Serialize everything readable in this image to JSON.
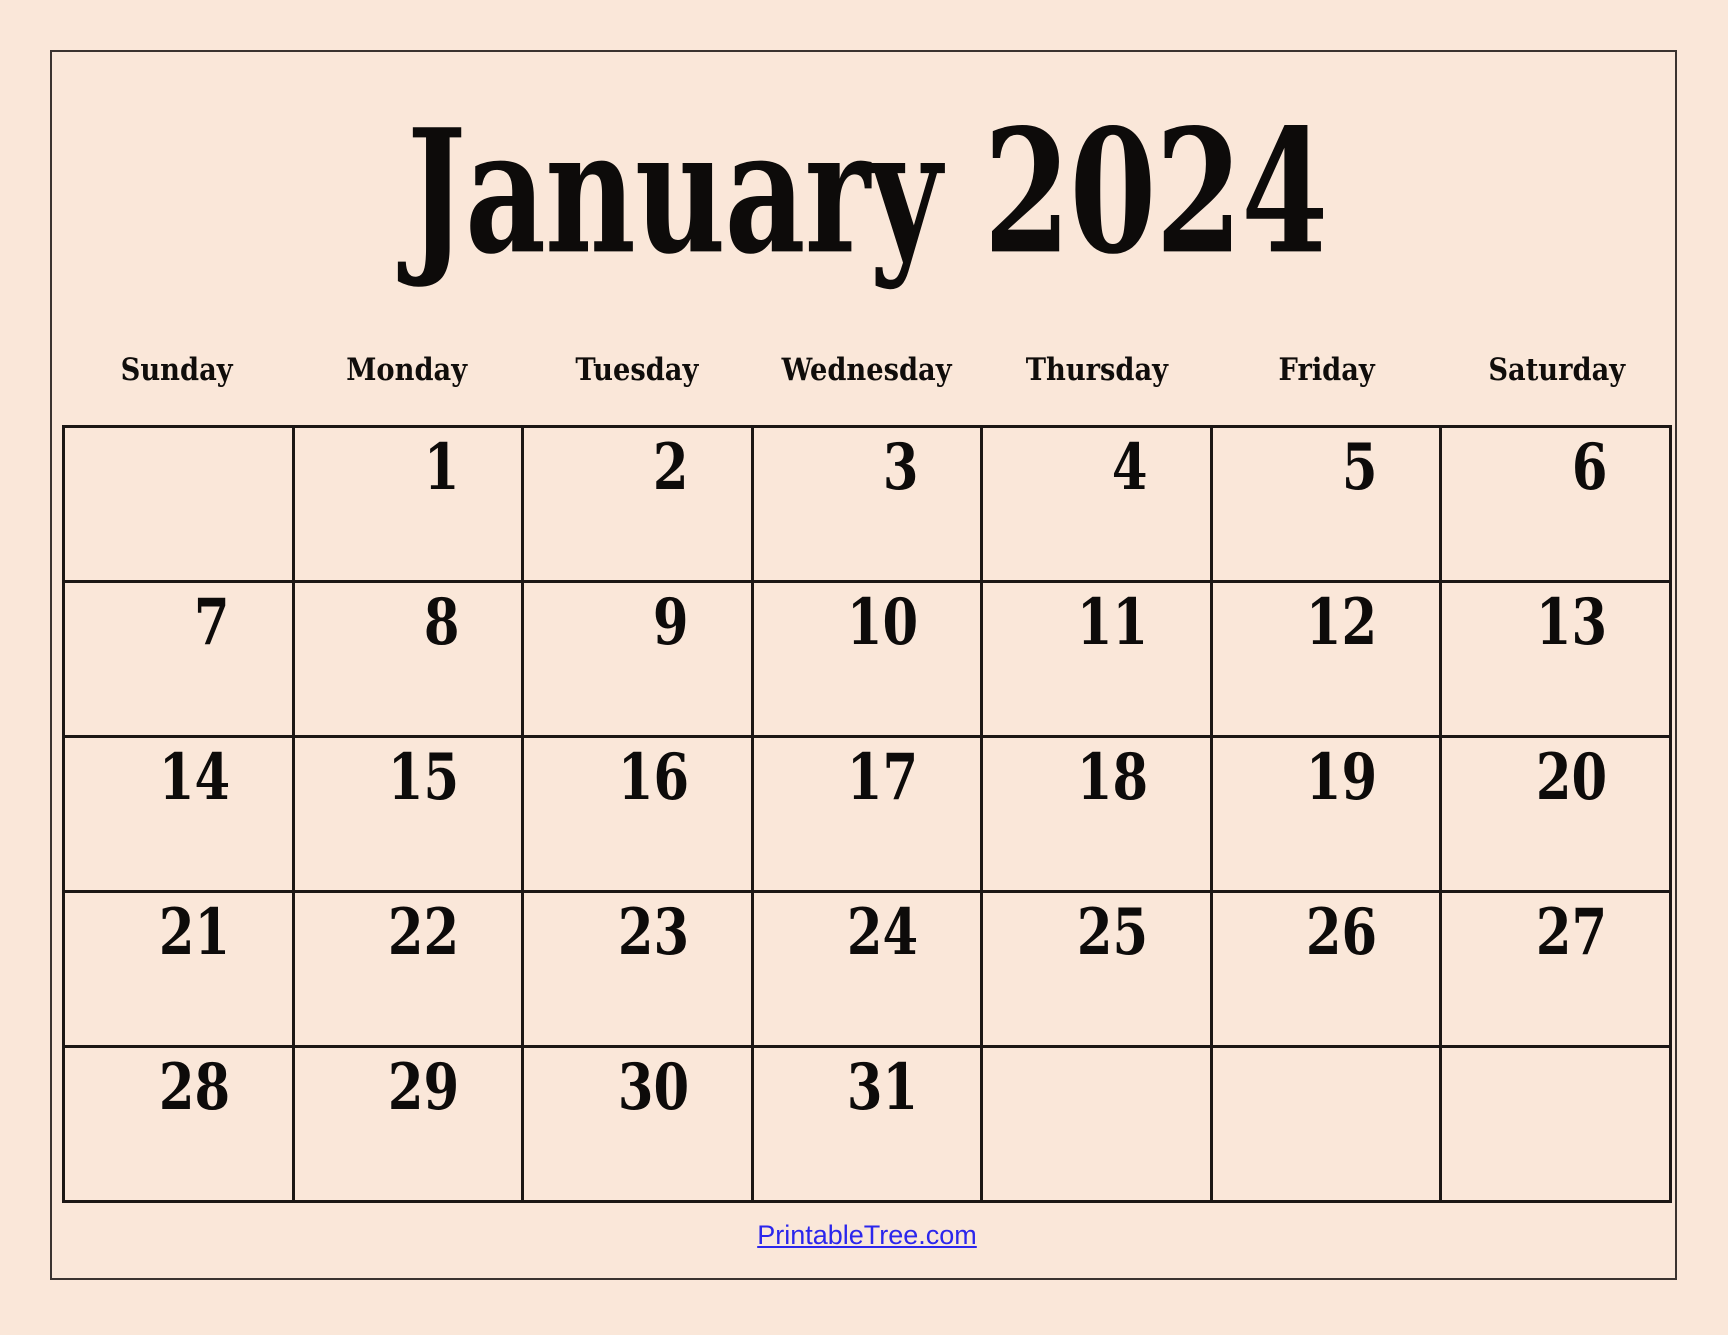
{
  "theme": {
    "background_color": "#FAE7D9",
    "ink_color": "#0D0B0A",
    "grid_line_color": "#1C1715",
    "link_color": "#2B26EC"
  },
  "header": {
    "title": "January 2024",
    "month": "January",
    "year": "2024"
  },
  "weekdays": [
    {
      "label": "Sunday"
    },
    {
      "label": "Monday"
    },
    {
      "label": "Tuesday"
    },
    {
      "label": "Wednesday"
    },
    {
      "label": "Thursday"
    },
    {
      "label": "Friday"
    },
    {
      "label": "Saturday"
    }
  ],
  "weeks": [
    {
      "days": [
        {
          "num": ""
        },
        {
          "num": "1"
        },
        {
          "num": "2"
        },
        {
          "num": "3"
        },
        {
          "num": "4"
        },
        {
          "num": "5"
        },
        {
          "num": "6"
        }
      ]
    },
    {
      "days": [
        {
          "num": "7"
        },
        {
          "num": "8"
        },
        {
          "num": "9"
        },
        {
          "num": "10"
        },
        {
          "num": "11"
        },
        {
          "num": "12"
        },
        {
          "num": "13"
        }
      ]
    },
    {
      "days": [
        {
          "num": "14"
        },
        {
          "num": "15"
        },
        {
          "num": "16"
        },
        {
          "num": "17"
        },
        {
          "num": "18"
        },
        {
          "num": "19"
        },
        {
          "num": "20"
        }
      ]
    },
    {
      "days": [
        {
          "num": "21"
        },
        {
          "num": "22"
        },
        {
          "num": "23"
        },
        {
          "num": "24"
        },
        {
          "num": "25"
        },
        {
          "num": "26"
        },
        {
          "num": "27"
        }
      ]
    },
    {
      "days": [
        {
          "num": "28"
        },
        {
          "num": "29"
        },
        {
          "num": "30"
        },
        {
          "num": "31"
        },
        {
          "num": ""
        },
        {
          "num": ""
        },
        {
          "num": ""
        }
      ]
    }
  ],
  "footer": {
    "link_label": "PrintableTree.com"
  }
}
